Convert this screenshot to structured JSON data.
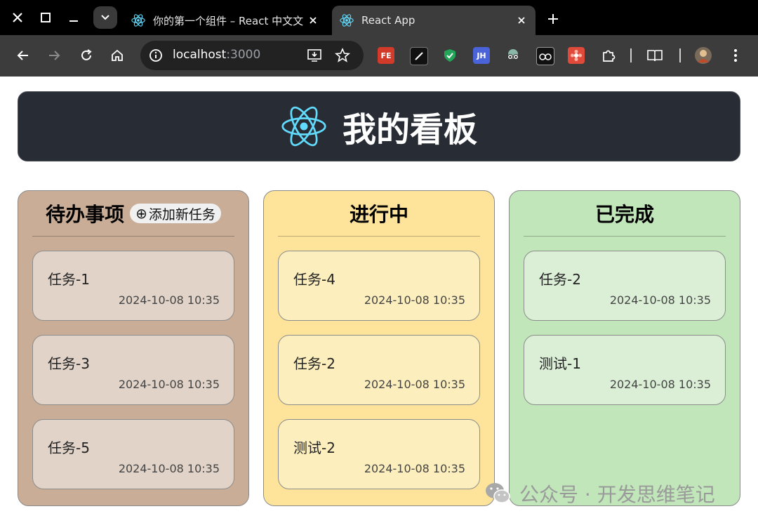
{
  "browser": {
    "tabs": [
      {
        "title": "你的第一个组件 – React 中文文",
        "active": false
      },
      {
        "title": "React App",
        "active": true
      }
    ],
    "url_host": "localhost",
    "url_port": ":3000",
    "extensions": [
      "FE",
      "JH"
    ]
  },
  "page": {
    "title": "我的看板",
    "columns": [
      {
        "title": "待办事项",
        "add_label": "添加新任务",
        "add_symbol": "⊕",
        "color": "#c9ad97",
        "cards": [
          {
            "title": "任务-1",
            "time": "2024-10-08 10:35"
          },
          {
            "title": "任务-3",
            "time": "2024-10-08 10:35"
          },
          {
            "title": "任务-5",
            "time": "2024-10-08 10:35"
          }
        ]
      },
      {
        "title": "进行中",
        "color": "#fde49a",
        "cards": [
          {
            "title": "任务-4",
            "time": "2024-10-08 10:35"
          },
          {
            "title": "任务-2",
            "time": "2024-10-08 10:35"
          },
          {
            "title": "测试-2",
            "time": "2024-10-08 10:35"
          }
        ]
      },
      {
        "title": "已完成",
        "color": "#c0e6ba",
        "cards": [
          {
            "title": "任务-2",
            "time": "2024-10-08 10:35"
          },
          {
            "title": "测试-1",
            "time": "2024-10-08 10:35"
          }
        ]
      }
    ]
  },
  "watermark": "公众号 · 开发思维笔记",
  "colors": {
    "header_bg": "#282c34",
    "react_blue": "#61dafb"
  }
}
